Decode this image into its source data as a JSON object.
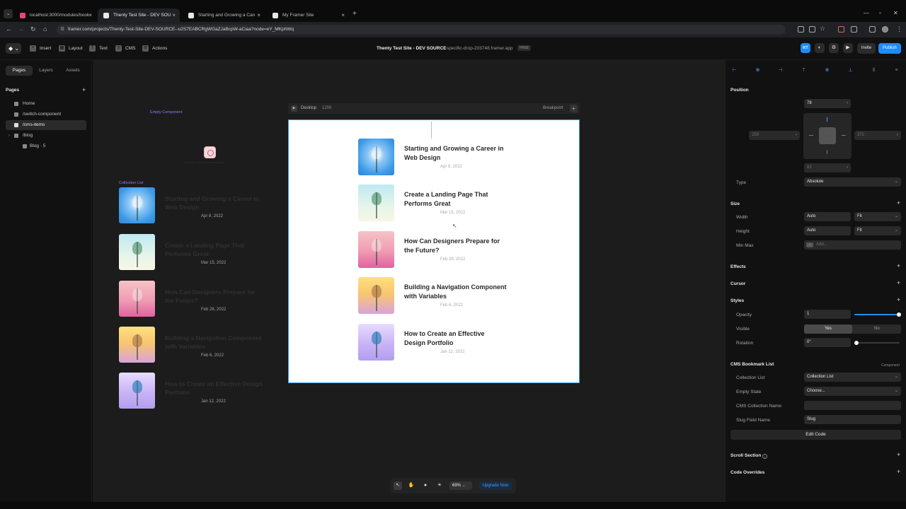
{
  "browser": {
    "tabs": [
      {
        "title": "localhost:3000/modules/book",
        "active": false,
        "color": "#e8457a"
      },
      {
        "title": "Thenty Test Site - DEV SOURCE",
        "active": true,
        "color": "#e8e8e8"
      },
      {
        "title": "Starting and Growing a Career",
        "active": false,
        "color": "#e8e8e8"
      },
      {
        "title": "My Framer Site",
        "active": false,
        "color": "#e8e8e8"
      }
    ],
    "url": "framer.com/projects/Thenty-Test-Site-DEV-SOURCE--u2S7EABCRgWGaZJaBcpW-aCiaa?node=eY_MKphWq"
  },
  "toolbar": {
    "insert": "Insert",
    "layout": "Layout",
    "text": "Text",
    "cms": "CMS",
    "actions": "Actions",
    "project_title": "Thenty Test Site - DEV SOURCE",
    "domain": "specific-drop-203748.framer.app",
    "plan_badge": "FREE",
    "avatar_initials": "KT",
    "invite": "Invite",
    "publish": "Publish",
    "accent": "#1e8bff"
  },
  "left_panel": {
    "tabs": [
      "Pages",
      "Layers",
      "Assets"
    ],
    "heading": "Pages",
    "pages": [
      {
        "label": "Home",
        "active": false
      },
      {
        "label": "/switch-component",
        "active": false
      },
      {
        "label": "/cms-items",
        "active": true
      },
      {
        "label": "/blog",
        "active": false
      },
      {
        "label": "Blog · 5",
        "active": false
      }
    ]
  },
  "canvas": {
    "empty_label": "Empty Component",
    "empty_text": "You have no bookmarked posts",
    "collection_label": "Collection List",
    "frame_name": "Desktop",
    "frame_width": "1200",
    "breakpoint": "Breakpoint",
    "zoom": "69%",
    "upgrade": "Upgrade Now"
  },
  "posts": [
    {
      "title": "Starting and Growing a Career in Web Design",
      "date": "Apr 8, 2022",
      "image": "blue-dried-flower"
    },
    {
      "title": "Create a Landing Page That Performs Great",
      "date": "Mar 15, 2022",
      "image": "green-sprig"
    },
    {
      "title": "How Can Designers Prepare for the Future?",
      "date": "Feb 28, 2022",
      "image": "pink-leaf"
    },
    {
      "title": "Building a Navigation Component with Variables",
      "date": "Feb 6, 2022",
      "image": "dry-flower-yellow"
    },
    {
      "title": "How to Create an Effective Design Portfolio",
      "date": "Jan 12, 2022",
      "image": "blue-tree-lavender"
    }
  ],
  "right_panel": {
    "position": {
      "heading": "Position",
      "top": "78",
      "left": "259",
      "right": "372",
      "bottom": "82",
      "type_label": "Type",
      "type_value": "Absolute"
    },
    "size": {
      "heading": "Size",
      "width_label": "Width",
      "width_value": "Auto",
      "width_mode": "Fit",
      "height_label": "Height",
      "height_value": "Auto",
      "height_mode": "Fit",
      "minmax_label": "Min Max",
      "minmax_placeholder": "Add..."
    },
    "effects": "Effects",
    "cursor": "Cursor",
    "styles": {
      "heading": "Styles",
      "opacity_label": "Opacity",
      "opacity_value": "1",
      "visible_label": "Visible",
      "visible_yes": "Yes",
      "visible_no": "No",
      "rotation_label": "Rotation",
      "rotation_value": "0°"
    },
    "cms": {
      "heading": "CMS Bookmark List",
      "tag": "Component",
      "collection_list_label": "Collection List",
      "collection_list_value": "Collection List",
      "empty_state_label": "Empty State",
      "empty_state_value": "Choose...",
      "collection_name_label": "CMS Collection Name",
      "collection_name_value": "",
      "slug_label": "Slug Field Name",
      "slug_value": "Slug",
      "edit_code": "Edit Code"
    },
    "scroll_section": "Scroll Section",
    "code_overrides": "Code Overrides"
  }
}
